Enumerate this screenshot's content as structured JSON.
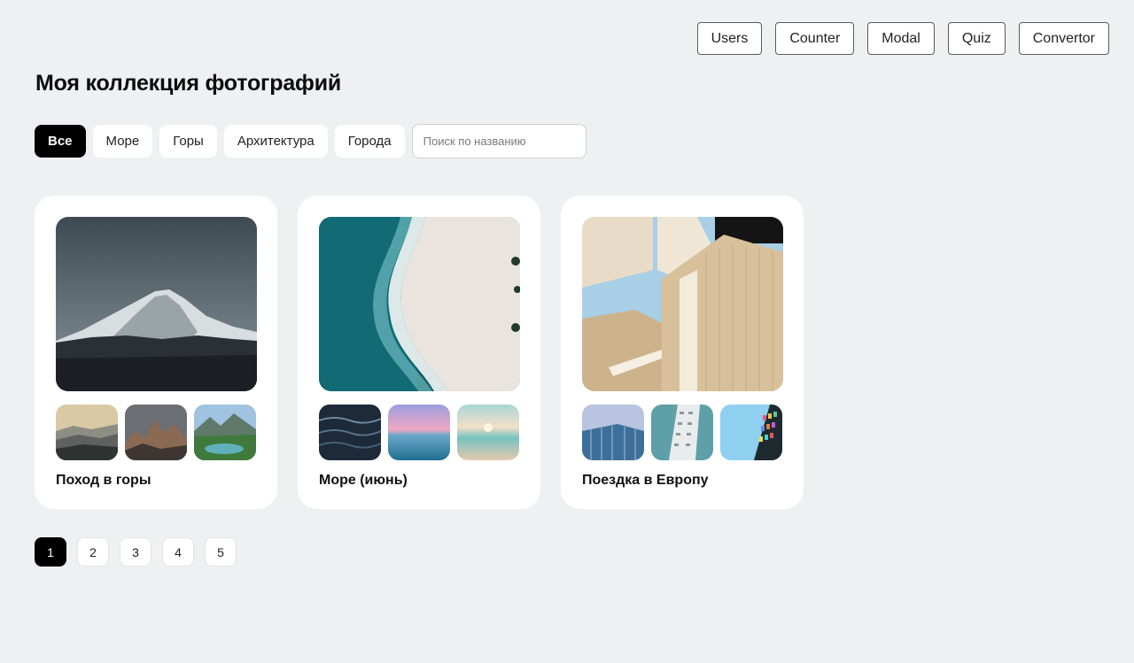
{
  "nav": {
    "items": [
      "Users",
      "Counter",
      "Modal",
      "Quiz",
      "Convertor"
    ]
  },
  "page_title": "Моя коллекция фотографий",
  "filters": {
    "categories": [
      "Все",
      "Море",
      "Горы",
      "Архитектура",
      "Города"
    ],
    "active": "Все",
    "search_placeholder": "Поиск по названию",
    "search_value": ""
  },
  "collections": [
    {
      "title": "Поход в горы",
      "main_image": "snowy-mountain-photo",
      "thumbnails": [
        "misty-ridges-photo",
        "rocky-peaks-photo",
        "alpine-lake-photo"
      ]
    },
    {
      "title": "Море (июнь)",
      "main_image": "aerial-wave-beach-photo",
      "thumbnails": [
        "dark-water-photo",
        "pink-sunset-sea-photo",
        "beach-sunset-photo"
      ]
    },
    {
      "title": "Поездка в Европу",
      "main_image": "wooden-architecture-photo",
      "thumbnails": [
        "glass-building-photo",
        "white-tower-photo",
        "colorful-facade-photo"
      ]
    }
  ],
  "pagination": {
    "pages": [
      "1",
      "2",
      "3",
      "4",
      "5"
    ],
    "current": "1"
  },
  "colors": {
    "background": "#eff0f2",
    "card": "#ffffff",
    "accent": "#000000"
  }
}
